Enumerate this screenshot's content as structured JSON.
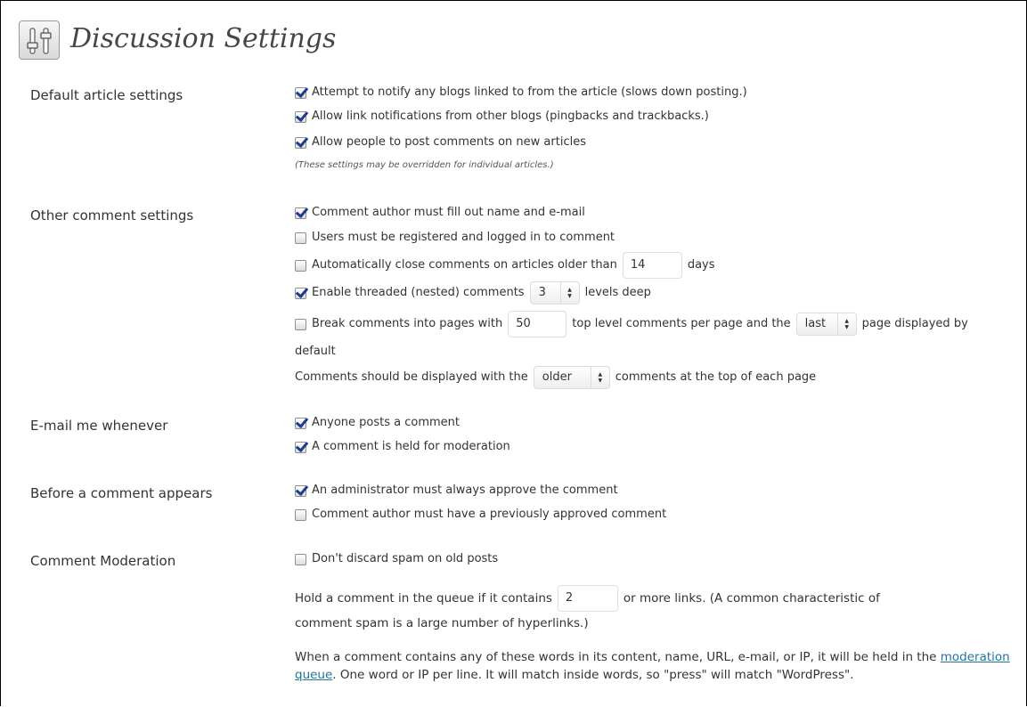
{
  "page": {
    "title": "Discussion Settings",
    "icon": "settings-sliders-icon"
  },
  "sections": {
    "default_article": {
      "label": "Default article settings",
      "options": [
        {
          "label": "Attempt to notify any blogs linked to from the article (slows down posting.)",
          "checked": true
        },
        {
          "label": "Allow link notifications from other blogs (pingbacks and trackbacks.)",
          "checked": true
        },
        {
          "label": "Allow people to post comments on new articles",
          "checked": true
        }
      ],
      "note": "(These settings may be overridden for individual articles.)"
    },
    "other_comment": {
      "label": "Other comment settings",
      "author_fill": {
        "label": "Comment author must fill out name and e-mail",
        "checked": true
      },
      "registered": {
        "label": "Users must be registered and logged in to comment",
        "checked": false
      },
      "auto_close": {
        "label_before": "Automatically close comments on articles older than",
        "value": "14",
        "label_after": "days",
        "checked": false
      },
      "threaded": {
        "label_before": "Enable threaded (nested) comments",
        "value": "3",
        "label_after": "levels deep",
        "checked": true
      },
      "paging": {
        "label_before": "Break comments into pages with",
        "value": "50",
        "label_middle": "top level comments per page and the",
        "select_value": "last",
        "label_after": "page displayed by",
        "label_wrap": "default",
        "checked": false
      },
      "order": {
        "label_before": "Comments should be displayed with the",
        "select_value": "older",
        "label_after": "comments at the top of each page"
      }
    },
    "email_me": {
      "label": "E-mail me whenever",
      "options": [
        {
          "label": "Anyone posts a comment",
          "checked": true
        },
        {
          "label": "A comment is held for moderation",
          "checked": true
        }
      ]
    },
    "before_appears": {
      "label": "Before a comment appears",
      "options": [
        {
          "label": "An administrator must always approve the comment",
          "checked": true
        },
        {
          "label": "Comment author must have a previously approved comment",
          "checked": false
        }
      ]
    },
    "moderation": {
      "label": "Comment Moderation",
      "spam": {
        "label": "Don't discard spam on old posts",
        "checked": false
      },
      "hold_before": "Hold a comment in the queue if it contains",
      "hold_value": "2",
      "hold_after": "or more links. (A common characteristic of",
      "hold_wrap": "comment spam is a large number of hyperlinks.)",
      "words_before": "When a comment contains any of these words in its content, name, URL, e-mail, or IP, it will be held in the",
      "words_link": "moderation queue",
      "words_after": ". One word or IP per line. It will match inside words, so \"press\" will match \"WordPress\"."
    }
  },
  "colors": {
    "link": "#21759b",
    "checkmark": "#1a3d8f",
    "title": "#464646"
  }
}
